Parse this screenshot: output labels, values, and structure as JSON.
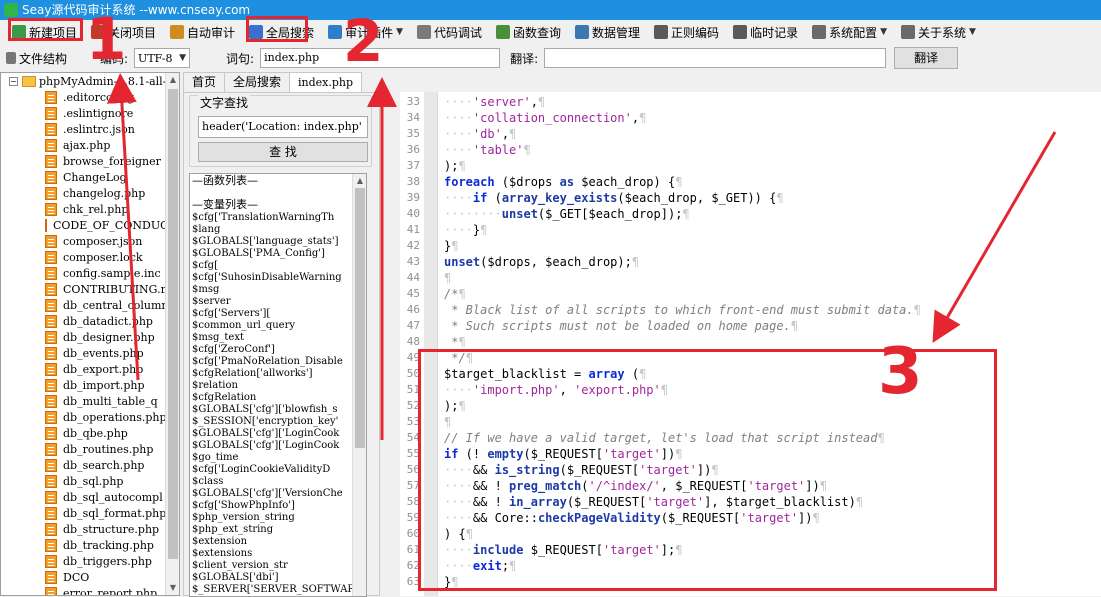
{
  "window": {
    "title": "Seay源代码审计系统  --www.cnseay.com"
  },
  "menu": [
    {
      "label": "新建项目",
      "icon": "new-project-icon",
      "color": "#3a9a4a"
    },
    {
      "label": "关闭项目",
      "icon": "close-project-icon",
      "color": "#c33a2a"
    },
    {
      "label": "自动审计",
      "icon": "auto-audit-icon",
      "color": "#d08b20"
    },
    {
      "label": "全局搜索",
      "icon": "global-search-icon",
      "color": "#3b6fd0"
    },
    {
      "label": "审计插件",
      "icon": "audit-plugin-icon",
      "color": "#2f7fc8"
    },
    {
      "label": "代码调试",
      "icon": "code-debug-icon",
      "color": "#7a7a7a"
    },
    {
      "label": "函数查询",
      "icon": "function-query-icon",
      "color": "#4a8f3a"
    },
    {
      "label": "数据管理",
      "icon": "data-manage-icon",
      "color": "#3a7ab0"
    },
    {
      "label": "正则编码",
      "icon": "regex-encode-icon",
      "color": "#5a5a5a"
    },
    {
      "label": "临时记录",
      "icon": "temp-record-icon",
      "color": "#5a5a5a"
    },
    {
      "label": "系统配置",
      "icon": "system-config-icon",
      "color": "#6a6a6a"
    },
    {
      "label": "关于系统",
      "icon": "about-icon",
      "color": "#6a6a6a"
    }
  ],
  "toolbar": {
    "filestruct_label": "文件结构",
    "encoding_label": "编码:",
    "encoding_value": "UTF-8",
    "word_label": "词句:",
    "word_value": "index.php",
    "translate_label": "翻译:",
    "translate_value": "",
    "translate_button": "翻译"
  },
  "tree": {
    "root": "phpMyAdmin-4.8.1-all-",
    "files": [
      ".editorconfig",
      ".eslintignore",
      ".eslintrc.json",
      "ajax.php",
      "browse_foreigner",
      "ChangeLog",
      "changelog.php",
      "chk_rel.php",
      "CODE_OF_CONDUCT.md",
      "composer.json",
      "composer.lock",
      "config.sample.inc",
      "CONTRIBUTING.md",
      "db_central_column",
      "db_datadict.php",
      "db_designer.php",
      "db_events.php",
      "db_export.php",
      "db_import.php",
      "db_multi_table_q",
      "db_operations.php",
      "db_qbe.php",
      "db_routines.php",
      "db_search.php",
      "db_sql.php",
      "db_sql_autocompl",
      "db_sql_format.php",
      "db_structure.php",
      "db_tracking.php",
      "db_triggers.php",
      "DCO",
      "error_report.php"
    ]
  },
  "tabs": [
    "首页",
    "全局搜索",
    "index.php"
  ],
  "search_panel": {
    "group_title": "文字查找",
    "search_value": "header('Location: index.php'",
    "find_button": "查 找"
  },
  "func_list": {
    "func_header": "—函数列表—",
    "var_header": "—变量列表—",
    "vars": [
      "$cfg['TranslationWarningTh",
      "$lang",
      "$GLOBALS['language_stats']",
      "$GLOBALS['PMA_Config']",
      "$cfg[",
      "$cfg['SuhosinDisableWarning",
      "$msg",
      "$server",
      "$cfg['Servers'][",
      "$common_url_query",
      "$msg_text",
      "$cfg['ZeroConf']",
      "$cfg['PmaNoRelation_Disable",
      "$cfgRelation['allworks']",
      "$relation",
      "$cfgRelation",
      "$GLOBALS['cfg']['blowfish_s",
      "$_SESSION['encryption_key'",
      "$GLOBALS['cfg']['LoginCook",
      "$GLOBALS['cfg']['LoginCook",
      "$go_time",
      "$cfg['LoginCookieValidityD",
      "$class",
      "$GLOBALS['cfg']['VersionChe",
      "$cfg['ShowPhpInfo']",
      "$php_version_string",
      "$php_ext_string",
      "$extension",
      "$extensions",
      "$client_version_str",
      "$GLOBALS['dbi']",
      "$_SERVER['SERVER_SOFTWARE']"
    ]
  },
  "code": [
    {
      "n": "33",
      "html": "<span class=\"d\">····</span><span class=\"s\">'server'</span>,<span class=\"d\">¶</span>"
    },
    {
      "n": "34",
      "html": "<span class=\"d\">····</span><span class=\"s\">'collation_connection'</span>,<span class=\"d\">¶</span>"
    },
    {
      "n": "35",
      "html": "<span class=\"d\">····</span><span class=\"s\">'db'</span>,<span class=\"d\">¶</span>"
    },
    {
      "n": "36",
      "html": "<span class=\"d\">····</span><span class=\"s\">'table'</span><span class=\"d\">¶</span>"
    },
    {
      "n": "37",
      "html": ");<span class=\"d\">¶</span>"
    },
    {
      "n": "38",
      "html": "<span class=\"k\">foreach</span> ($drops <span class=\"f\">as</span> $each_drop) {<span class=\"d\">¶</span>"
    },
    {
      "n": "39",
      "html": "<span class=\"d\">····</span><span class=\"k\">if</span> (<span class=\"f\">array_key_exists</span>($each_drop, $_GET)) {<span class=\"d\">¶</span>"
    },
    {
      "n": "40",
      "html": "<span class=\"d\">········</span><span class=\"f\">unset</span>($_GET[$each_drop]);<span class=\"d\">¶</span>"
    },
    {
      "n": "41",
      "html": "<span class=\"d\">····</span>}<span class=\"d\">¶</span>"
    },
    {
      "n": "42",
      "html": "}<span class=\"d\">¶</span>"
    },
    {
      "n": "43",
      "html": "<span class=\"f\">unset</span>($drops, $each_drop);<span class=\"d\">¶</span>"
    },
    {
      "n": "44",
      "html": "<span class=\"d\">¶</span>"
    },
    {
      "n": "45",
      "html": "<span class=\"c\">/*</span><span class=\"d\">¶</span>"
    },
    {
      "n": "46",
      "html": "<span class=\"c\"> * Black list of all scripts to which front-end must submit data.</span><span class=\"d\">¶</span>"
    },
    {
      "n": "47",
      "html": "<span class=\"c\"> * Such scripts must not be loaded on home page.</span><span class=\"d\">¶</span>"
    },
    {
      "n": "48",
      "html": "<span class=\"c\"> *</span><span class=\"d\">¶</span>"
    },
    {
      "n": "49",
      "html": "<span class=\"c\"> */</span><span class=\"d\">¶</span>"
    },
    {
      "n": "50",
      "html": "$target_blacklist = <span class=\"k\">array</span> (<span class=\"d\">¶</span>"
    },
    {
      "n": "51",
      "html": "<span class=\"d\">····</span><span class=\"s\">'import.php'</span>, <span class=\"s\">'export.php'</span><span class=\"d\">¶</span>"
    },
    {
      "n": "52",
      "html": ");<span class=\"d\">¶</span>"
    },
    {
      "n": "53",
      "html": "<span class=\"d\">¶</span>"
    },
    {
      "n": "54",
      "html": "<span class=\"c\">// If we have a valid target, let's load that script instead</span><span class=\"d\">¶</span>"
    },
    {
      "n": "55",
      "html": "<span class=\"k\">if</span> (! <span class=\"f\">empty</span>($_REQUEST[<span class=\"s\">'target'</span>])<span class=\"d\">¶</span>"
    },
    {
      "n": "56",
      "html": "<span class=\"d\">····</span>&amp;&amp; <span class=\"f\">is_string</span>($_REQUEST[<span class=\"s\">'target'</span>])<span class=\"d\">¶</span>"
    },
    {
      "n": "57",
      "html": "<span class=\"d\">····</span>&amp;&amp; ! <span class=\"f\">preg_match</span>(<span class=\"s\">'/^index/'</span>, $_REQUEST[<span class=\"s\">'target'</span>])<span class=\"d\">¶</span>"
    },
    {
      "n": "58",
      "html": "<span class=\"d\">····</span>&amp;&amp; ! <span class=\"f\">in_array</span>($_REQUEST[<span class=\"s\">'target'</span>], $target_blacklist)<span class=\"d\">¶</span>"
    },
    {
      "n": "59",
      "html": "<span class=\"d\">····</span>&amp;&amp; Core::<span class=\"f\">checkPageValidity</span>($_REQUEST[<span class=\"s\">'target'</span>])<span class=\"d\">¶</span>"
    },
    {
      "n": "60",
      "html": ") {<span class=\"d\">¶</span>"
    },
    {
      "n": "61",
      "html": "<span class=\"d\">····</span><span class=\"f\">include</span> $_REQUEST[<span class=\"s\">'target'</span>];<span class=\"d\">¶</span>"
    },
    {
      "n": "62",
      "html": "<span class=\"d\">····</span><span class=\"k\">exit</span>;<span class=\"d\">¶</span>"
    },
    {
      "n": "63",
      "html": "}<span class=\"d\">¶</span>"
    }
  ],
  "annotations": {
    "marker1": "1",
    "marker2": "2",
    "marker3": "3"
  }
}
